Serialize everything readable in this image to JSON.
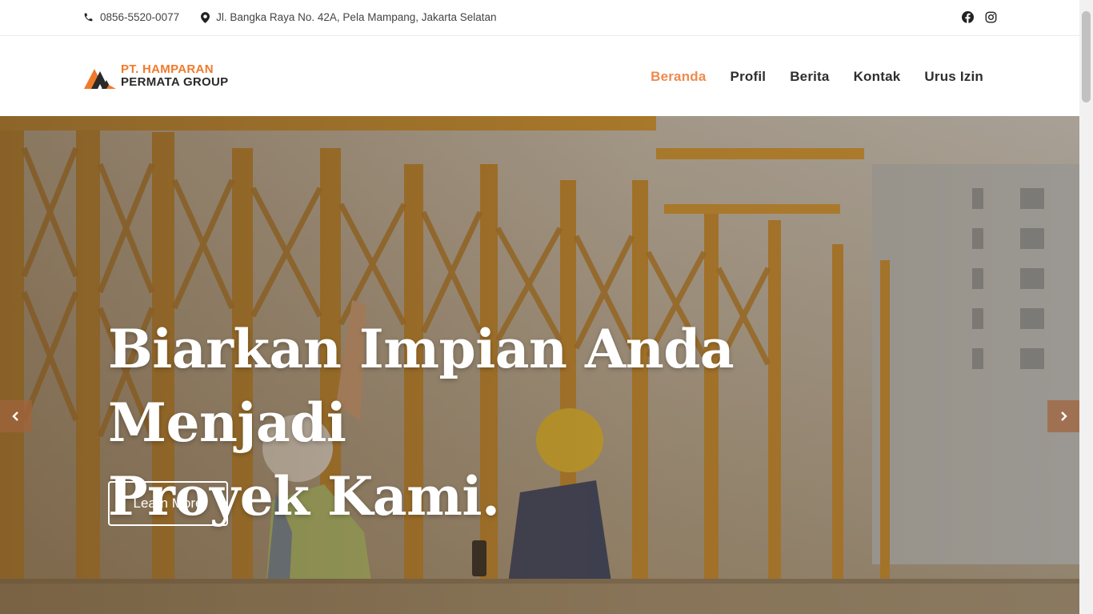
{
  "topbar": {
    "phone": "0856-5520-0077",
    "address": "Jl. Bangka Raya No. 42A, Pela Mampang, Jakarta Selatan",
    "icons": {
      "phone": "phone-icon",
      "address": "map-pin-icon",
      "facebook": "facebook-icon",
      "instagram": "instagram-icon"
    }
  },
  "header": {
    "logo_line1": "PT. HAMPARAN",
    "logo_line2": "PERMATA GROUP",
    "nav": [
      {
        "label": "Beranda",
        "active": true
      },
      {
        "label": "Profil",
        "active": false
      },
      {
        "label": "Berita",
        "active": false
      },
      {
        "label": "Kontak",
        "active": false
      },
      {
        "label": "Urus Izin",
        "active": false
      }
    ]
  },
  "hero": {
    "title_line1": "Biarkan Impian Anda Menjadi",
    "title_line2": "Proyek Kami.",
    "button_label": "Learn More",
    "prev_icon": "chevron-left-icon",
    "next_icon": "chevron-right-icon"
  },
  "colors": {
    "accent": "#ee8a4f",
    "logo_orange": "#f07a2b",
    "text_dark": "#2e2e2e"
  }
}
